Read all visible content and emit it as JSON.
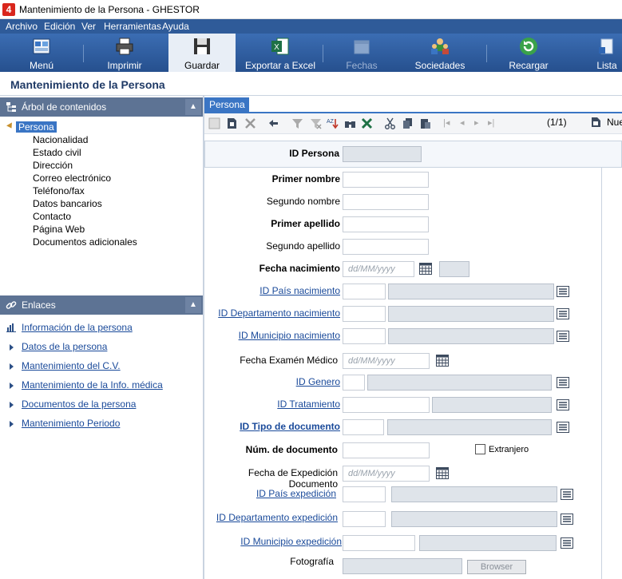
{
  "window": {
    "title": "Mantenimiento de la Persona - GHESTOR",
    "logo_text": "4"
  },
  "menu": [
    "Archivo",
    "Edición",
    "Ver",
    "Herramientas",
    "Ayuda"
  ],
  "toolbar": {
    "menu": "Menú",
    "imprimir": "Imprimir",
    "guardar": "Guardar",
    "exportar": "Exportar a Excel",
    "fechas": "Fechas",
    "sociedades": "Sociedades",
    "recargar": "Recargar",
    "lista": "Lista"
  },
  "page": {
    "title": "Mantenimiento de la Persona"
  },
  "tree": {
    "header": "Árbol de contenidos",
    "root": "Persona",
    "items": [
      "Nacionalidad",
      "Estado civil",
      "Dirección",
      "Correo electrónico",
      "Teléfono/fax",
      "Datos bancarios",
      "Contacto",
      "Página Web",
      "Documentos adicionales"
    ]
  },
  "links": {
    "header": "Enlaces",
    "items": [
      "Información de la persona",
      "Datos de la persona",
      "Mantenimiento del C.V.",
      "Mantenimiento de la Info. médica",
      "Documentos de la persona",
      "Mantenimiento Periodo"
    ]
  },
  "tab": {
    "label": "Persona"
  },
  "form_toolbar": {
    "record_count": "(1/1)",
    "nuevo": "Nue"
  },
  "form": {
    "id_persona": "ID Persona",
    "primer_nombre": "Primer nombre",
    "segundo_nombre": "Segundo nombre",
    "primer_apellido": "Primer apellido",
    "segundo_apellido": "Segundo apellido",
    "fecha_nacimiento": "Fecha nacimiento",
    "id_pais_nacimiento": "ID País nacimiento",
    "id_departamento_nacimiento": "ID Departamento nacimiento",
    "id_municipio_nacimiento": "ID Municipio nacimiento",
    "fecha_examen": "Fecha Examén Médico",
    "id_genero": "ID Genero",
    "id_tratamiento": "ID Tratamiento",
    "id_tipo_documento": "ID Tipo de documento",
    "num_documento": "Núm. de documento",
    "extranjero": "Extranjero",
    "fecha_expedicion": "Fecha de Expedición Documento",
    "id_pais_expedicion": "ID País expedición",
    "id_departamento_expedicion": "ID Departamento expedición",
    "id_municipio_expedicion": "ID Municipio expedición",
    "fotografia": "Fotografía",
    "browser": "Browser",
    "date_placeholder": "dd/MM/yyyy"
  }
}
